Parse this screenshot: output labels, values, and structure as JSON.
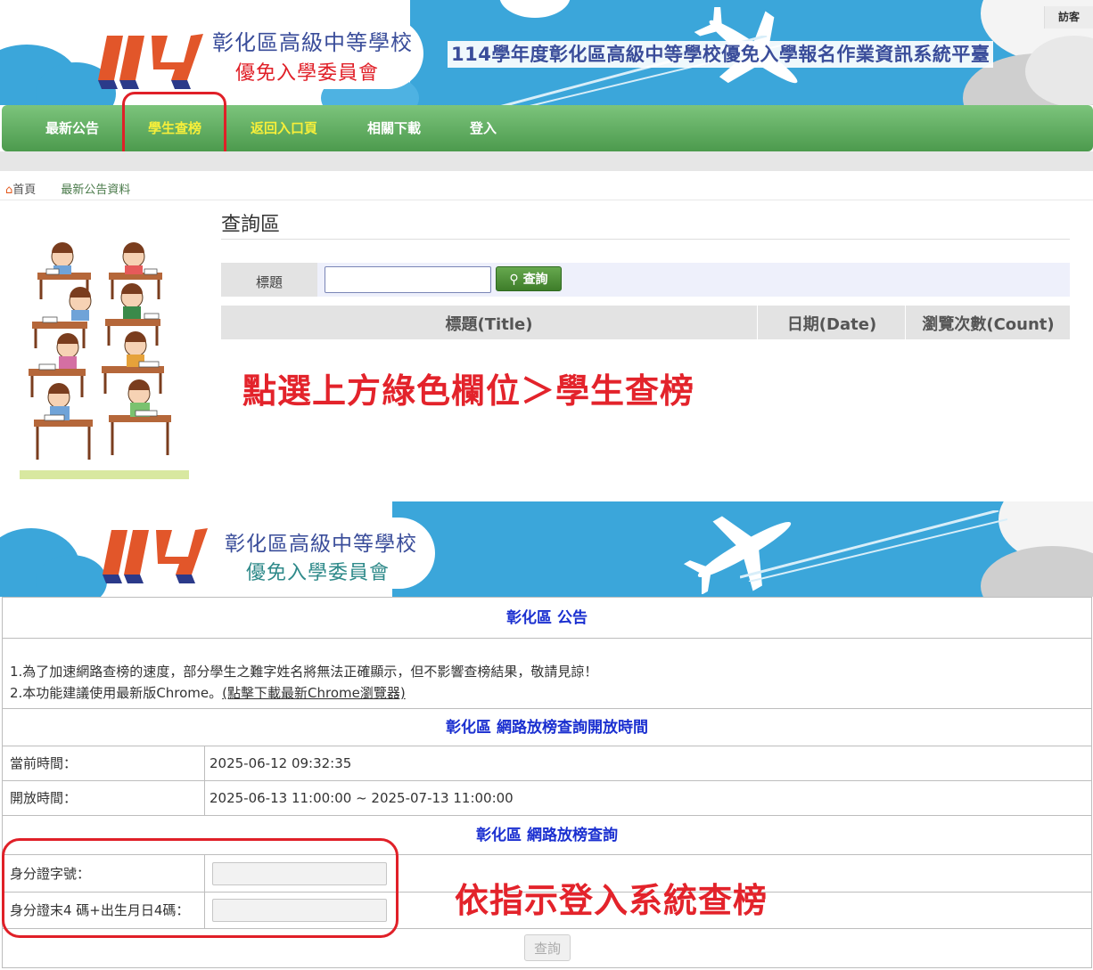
{
  "header": {
    "org_line1": "彰化區高級中等學校",
    "org_line2": "優免入學委員會",
    "logo_number": "114",
    "system_title": "114學年度彰化區高級中等學校優免入學報名作業資訊系統平臺",
    "visitor_label": "訪客"
  },
  "nav": {
    "items": [
      {
        "label": "最新公告"
      },
      {
        "label": "學生查榜"
      },
      {
        "label": "返回入口頁"
      },
      {
        "label": "相關下載"
      },
      {
        "label": "登入"
      }
    ]
  },
  "breadcrumb": {
    "home": "首頁",
    "current": "最新公告資料"
  },
  "search": {
    "section_title": "查詢區",
    "field_label": "標題",
    "input_value": "",
    "button_label": "查詢"
  },
  "table": {
    "columns": [
      "標題(Title)",
      "日期(Date)",
      "瀏覽次數(Count)"
    ]
  },
  "annotations": {
    "note1": "點選上方綠色欄位＞學生查榜",
    "note2": "依指示登入系統查榜"
  },
  "banner2": {
    "org_line1": "彰化區高級中等學校",
    "org_line2": "優免入學委員會",
    "logo_number": "114"
  },
  "board": {
    "notice_title": "彰化區 公告",
    "notice_line1": "1.為了加速網路查榜的速度，部分學生之難字姓名將無法正確顯示，但不影響查榜結果，敬請見諒！",
    "notice_line2_prefix": "2.本功能建議使用最新版Chrome。",
    "notice_line2_link": "(點擊下載最新Chrome瀏覽器)",
    "time_title": "彰化區 網路放榜查詢開放時間",
    "current_time_label": "當前時間：",
    "current_time_value": "2025-06-12 09:32:35",
    "open_time_label": "開放時間：",
    "open_time_value": "2025-06-13 11:00:00 ~ 2025-07-13 11:00:00",
    "query_title": "彰化區 網路放榜查詢",
    "id_label": "身分證字號：",
    "id_value": "",
    "id_tail_label": "身分證末4 碼+出生月日4碼：",
    "id_tail_value": "",
    "submit_label": "查詢"
  }
}
